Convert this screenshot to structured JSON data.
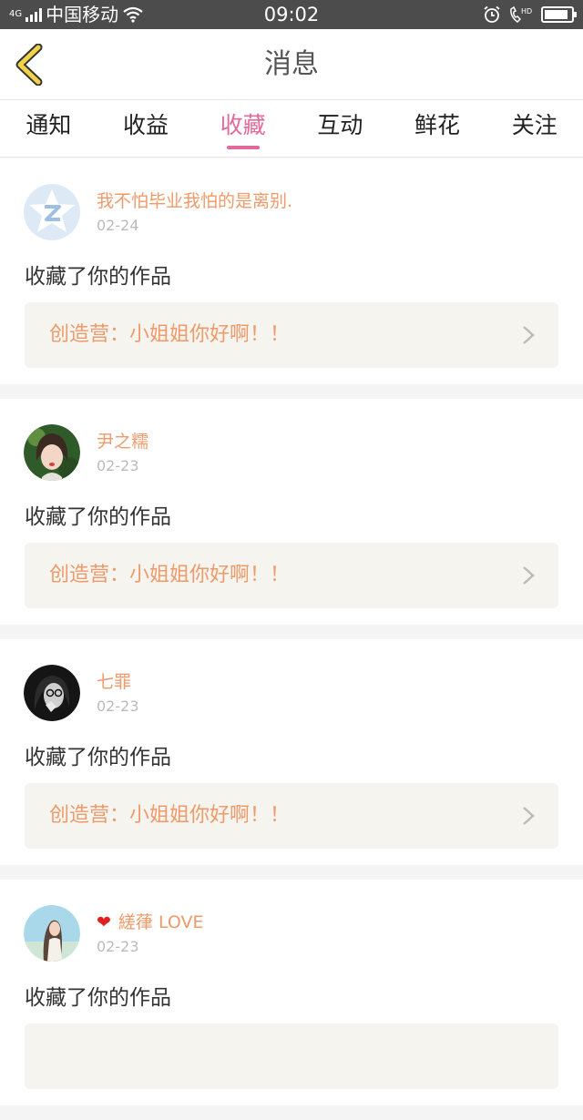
{
  "status_bar": {
    "network": "4G",
    "carrier": "中国移动",
    "time": "09:02",
    "battery_level": 0.9
  },
  "header": {
    "title": "消息"
  },
  "tabs": [
    {
      "label": "通知",
      "active": false
    },
    {
      "label": "收益",
      "active": false
    },
    {
      "label": "收藏",
      "active": true
    },
    {
      "label": "互动",
      "active": false
    },
    {
      "label": "鲜花",
      "active": false
    },
    {
      "label": "关注",
      "active": false
    }
  ],
  "messages": [
    {
      "user": "我不怕毕业我怕的是离别.",
      "date": "02-24",
      "action": "收藏了你的作品",
      "work": "创造营：小姐姐你好啊！！",
      "avatar": "default-star-avatar"
    },
    {
      "user": "尹之糯",
      "date": "02-23",
      "action": "收藏了你的作品",
      "work": "创造营：小姐姐你好啊！！",
      "avatar": "photo-avatar-girl"
    },
    {
      "user": "七罪",
      "date": "02-23",
      "action": "收藏了你的作品",
      "work": "创造营：小姐姐你好啊！！",
      "avatar": "photo-avatar-bw"
    },
    {
      "user": "縒葎 LOVE",
      "date": "02-23",
      "action": "收藏了你的作品",
      "work": "",
      "avatar": "photo-avatar-sky",
      "heart": "❤"
    }
  ],
  "colors": {
    "accent": "#e06a9a",
    "username": "#ee9a6a",
    "back_icon": "#f2d24a"
  }
}
